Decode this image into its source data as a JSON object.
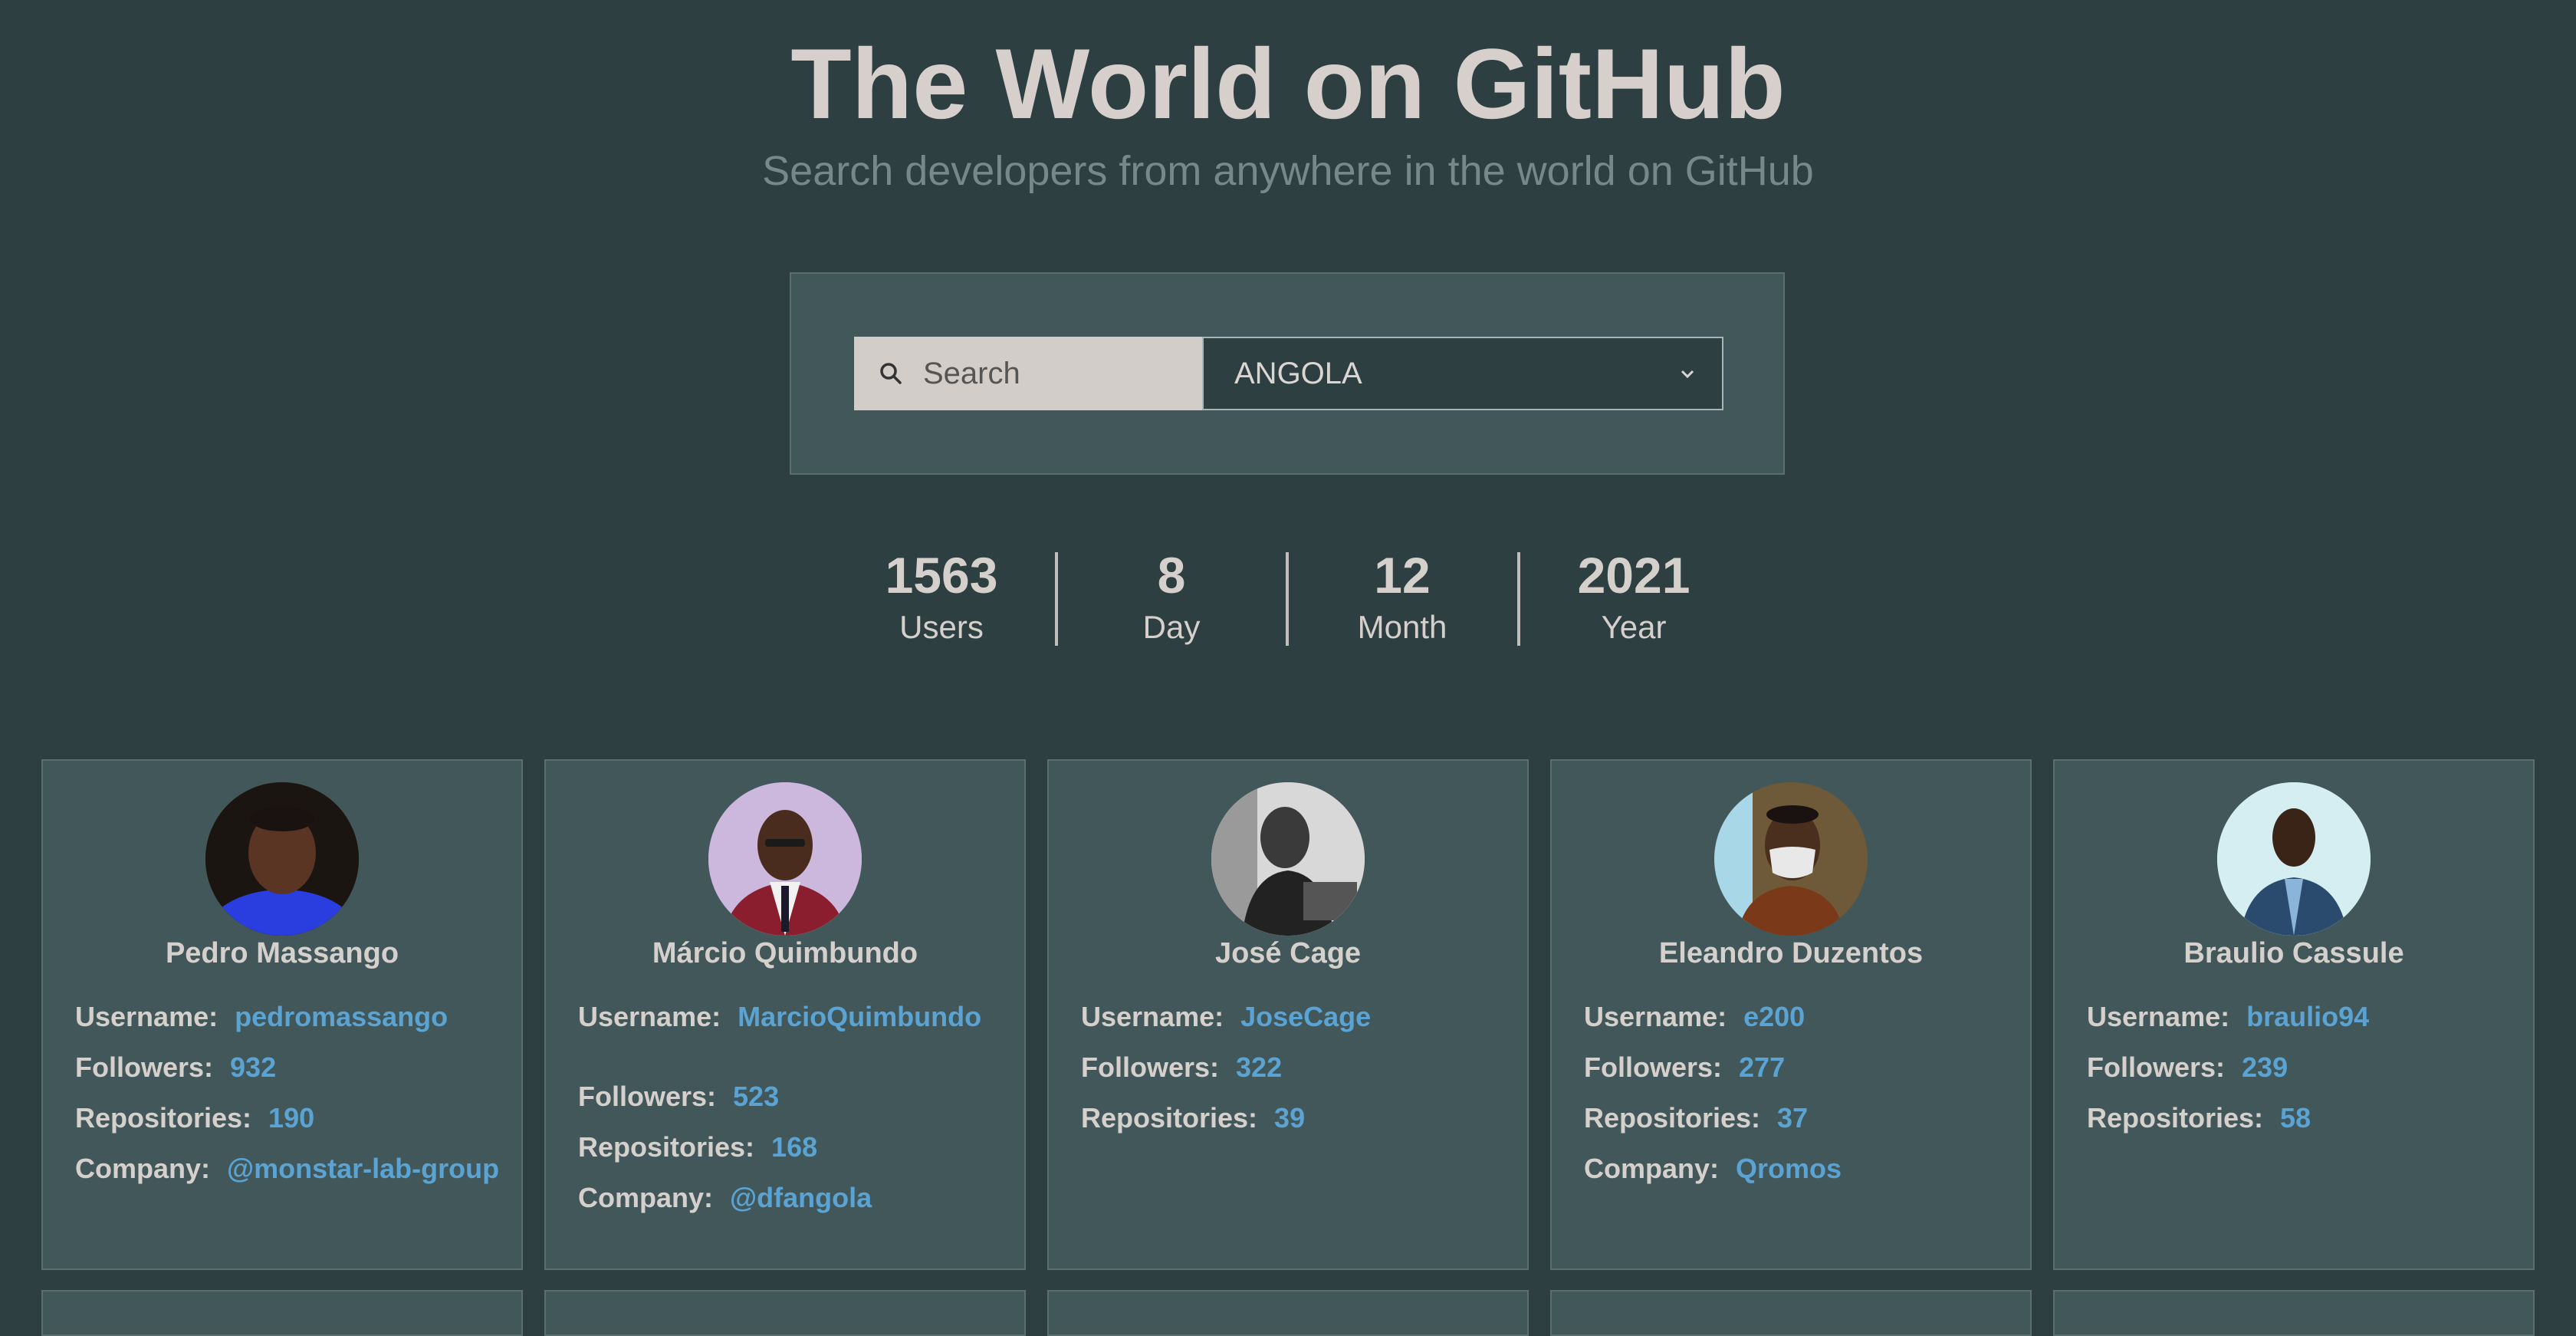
{
  "header": {
    "title": "The World on GitHub",
    "subtitle": "Search developers from anywhere in the world on GitHub"
  },
  "search": {
    "placeholder": "Search",
    "icon": "search-icon",
    "country": "ANGOLA"
  },
  "stats": [
    {
      "value": "1563",
      "label": "Users"
    },
    {
      "value": "8",
      "label": "Day"
    },
    {
      "value": "12",
      "label": "Month"
    },
    {
      "value": "2021",
      "label": "Year"
    }
  ],
  "labels": {
    "username": "Username:",
    "followers": "Followers:",
    "repositories": "Repositories:",
    "company": "Company:"
  },
  "colors": {
    "background": "#2d3f41",
    "card": "#42575a",
    "link": "#5aa3d2",
    "text": "#d6d0cd"
  },
  "users": [
    {
      "name": "Pedro Massango",
      "username": "pedromassango",
      "followers": "932",
      "repositories": "190",
      "company": "@monstar-lab-group"
    },
    {
      "name": "Márcio Quimbundo",
      "username": "MarcioQuimbundo",
      "followers": "523",
      "repositories": "168",
      "company": "@dfangola"
    },
    {
      "name": "José Cage",
      "username": "JoseCage",
      "followers": "322",
      "repositories": "39",
      "company": ""
    },
    {
      "name": "Eleandro Duzentos",
      "username": "e200",
      "followers": "277",
      "repositories": "37",
      "company": "Qromos"
    },
    {
      "name": "Braulio Cassule",
      "username": "braulio94",
      "followers": "239",
      "repositories": "58",
      "company": ""
    }
  ]
}
